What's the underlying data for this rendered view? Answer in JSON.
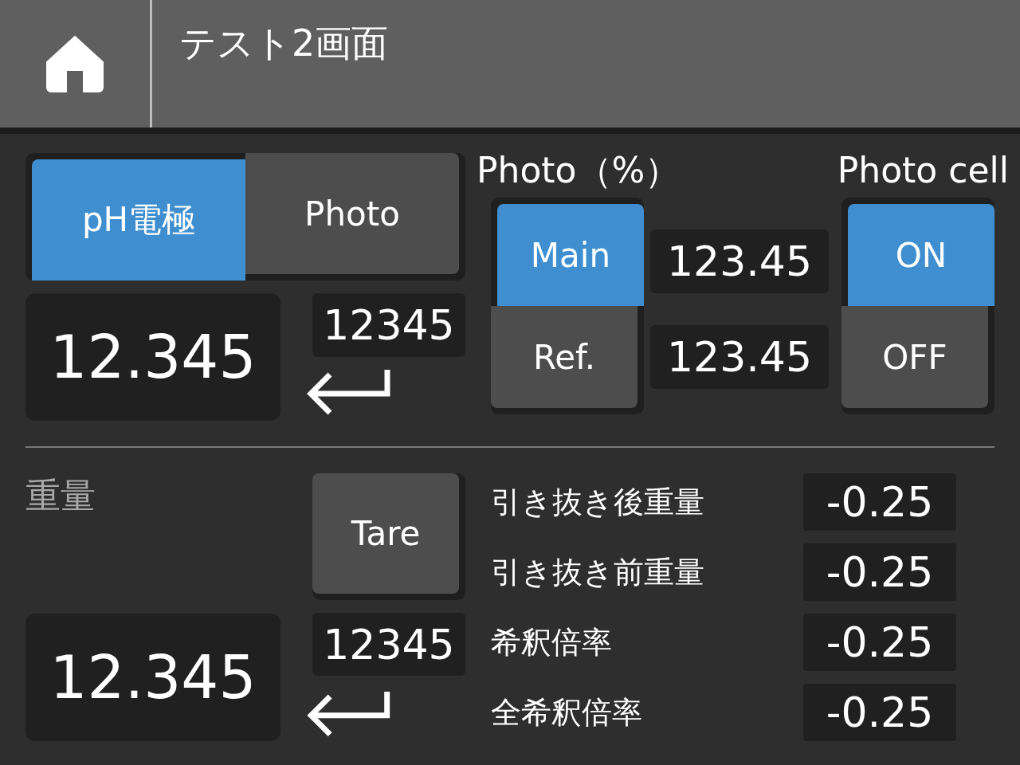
{
  "header": {
    "title": "テスト2画面"
  },
  "ph_section": {
    "mode_tabs": [
      {
        "label": "pH電極",
        "selected": true
      },
      {
        "label": "Photo",
        "selected": false
      }
    ],
    "value": "12.345",
    "input": "12345"
  },
  "photo_percent": {
    "title": "Photo（%）",
    "channels": [
      {
        "label": "Main",
        "selected": true,
        "value": "123.45"
      },
      {
        "label": "Ref.",
        "selected": false,
        "value": "123.45"
      }
    ]
  },
  "photo_cell": {
    "title": "Photo cell",
    "options": [
      {
        "label": "ON",
        "selected": true
      },
      {
        "label": "OFF",
        "selected": false
      }
    ]
  },
  "weight": {
    "title": "重量",
    "tare_button": "Tare",
    "value": "12.345",
    "input": "12345",
    "readings": [
      {
        "label": "引き抜き後重量",
        "value": "-0.25"
      },
      {
        "label": "引き抜き前重量",
        "value": "-0.25"
      },
      {
        "label": "希釈倍率",
        "value": "-0.25"
      },
      {
        "label": "全希釈倍率",
        "value": "-0.25"
      }
    ]
  }
}
